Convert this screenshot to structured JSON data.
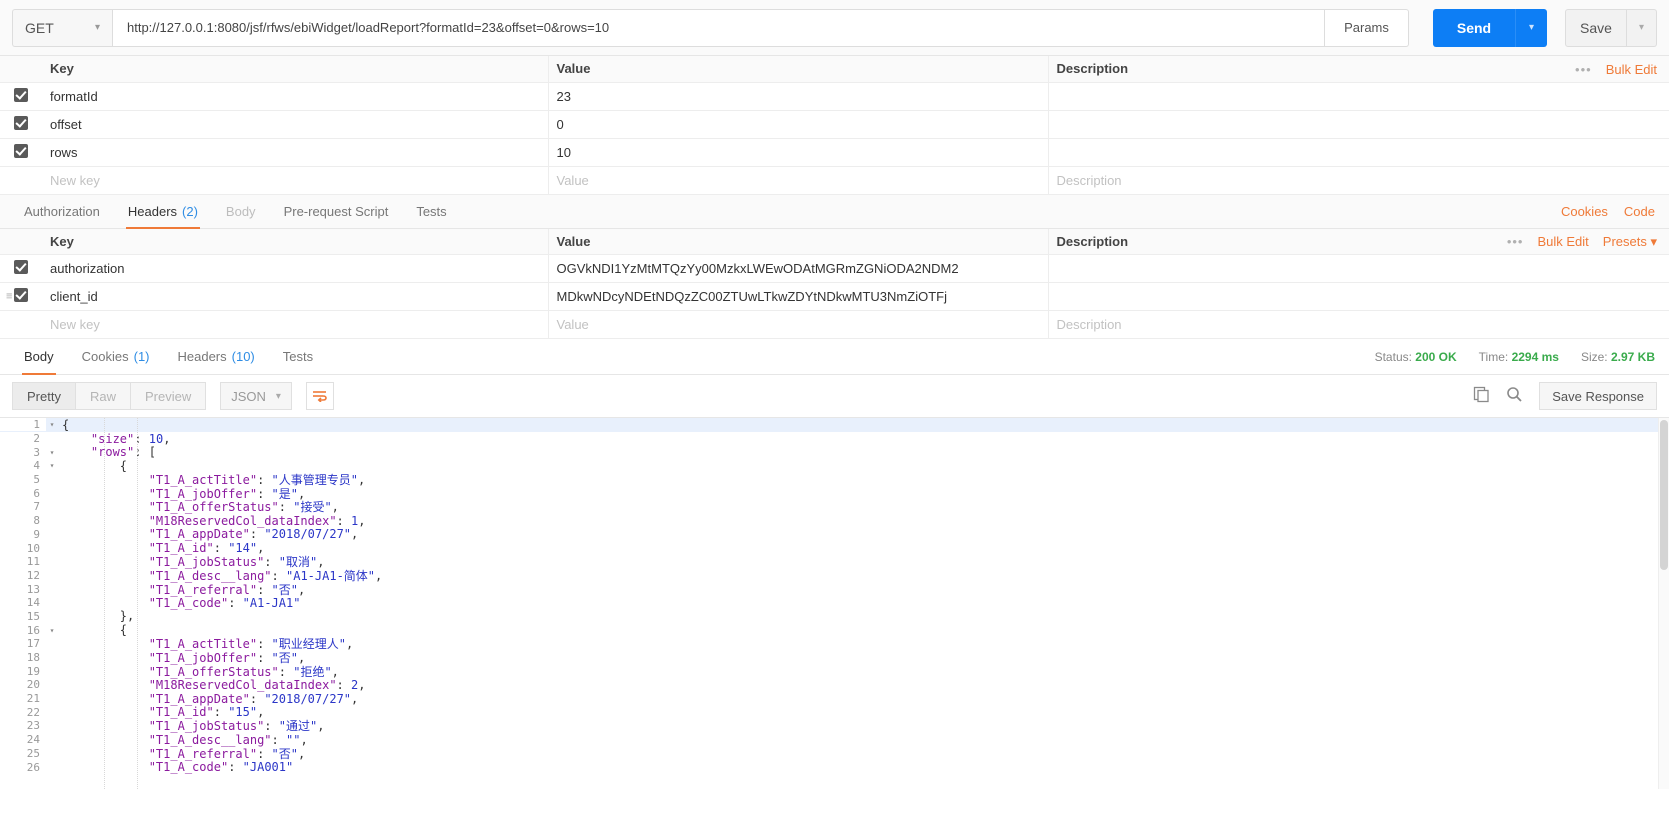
{
  "request": {
    "method": "GET",
    "url": "http://127.0.0.1:8080/jsf/rfws/ebiWidget/loadReport?formatId=23&offset=0&rows=10",
    "params_label": "Params",
    "send_label": "Send",
    "save_label": "Save"
  },
  "params_table": {
    "headers": {
      "key": "Key",
      "value": "Value",
      "description": "Description"
    },
    "bulk_edit": "Bulk Edit",
    "rows": [
      {
        "checked": true,
        "key": "formatId",
        "value": "23",
        "description": ""
      },
      {
        "checked": true,
        "key": "offset",
        "value": "0",
        "description": ""
      },
      {
        "checked": true,
        "key": "rows",
        "value": "10",
        "description": ""
      }
    ],
    "new_row": {
      "key": "New key",
      "value": "Value",
      "description": "Description"
    }
  },
  "request_tabs": {
    "items": [
      {
        "label": "Authorization",
        "count": "",
        "active": false,
        "dim": false
      },
      {
        "label": "Headers",
        "count": "(2)",
        "active": true,
        "dim": false
      },
      {
        "label": "Body",
        "count": "",
        "active": false,
        "dim": true
      },
      {
        "label": "Pre-request Script",
        "count": "",
        "active": false,
        "dim": false
      },
      {
        "label": "Tests",
        "count": "",
        "active": false,
        "dim": false
      }
    ],
    "cookies_link": "Cookies",
    "code_link": "Code"
  },
  "headers_table": {
    "headers": {
      "key": "Key",
      "value": "Value",
      "description": "Description"
    },
    "bulk_edit": "Bulk Edit",
    "presets": "Presets",
    "rows": [
      {
        "checked": true,
        "key": "authorization",
        "value": "OGVkNDI1YzMtMTQzYy00MzkxLWEwODAtMGRmZGNiODA2NDM2",
        "description": ""
      },
      {
        "checked": true,
        "key": "client_id",
        "value": "MDkwNDcyNDEtNDQzZC00ZTUwLTkwZDYtNDkwMTU3NmZiOTFj",
        "description": ""
      }
    ],
    "new_row": {
      "key": "New key",
      "value": "Value",
      "description": "Description"
    }
  },
  "response_tabs": {
    "items": [
      {
        "label": "Body",
        "count": "",
        "active": true
      },
      {
        "label": "Cookies",
        "count": "(1)",
        "active": false
      },
      {
        "label": "Headers",
        "count": "(10)",
        "active": false
      },
      {
        "label": "Tests",
        "count": "",
        "active": false
      }
    ],
    "status_label": "Status:",
    "status_value": "200 OK",
    "time_label": "Time:",
    "time_value": "2294 ms",
    "size_label": "Size:",
    "size_value": "2.97 KB"
  },
  "body_toolbar": {
    "views": [
      "Pretty",
      "Raw",
      "Preview"
    ],
    "active_view": "Pretty",
    "format": "JSON",
    "wrap_icon": "word-wrap-icon",
    "copy_icon": "copy-icon",
    "search_icon": "search-icon",
    "save_response": "Save Response"
  },
  "code": {
    "lines": [
      {
        "n": "1",
        "fold": "▾",
        "text": "{",
        "hl": true
      },
      {
        "n": "2",
        "fold": "",
        "text": "    \"size\": 10,"
      },
      {
        "n": "3",
        "fold": "▾",
        "text": "    \"rows\": ["
      },
      {
        "n": "4",
        "fold": "▾",
        "text": "        {"
      },
      {
        "n": "5",
        "fold": "",
        "text": "            \"T1_A_actTitle\": \"人事管理专员\","
      },
      {
        "n": "6",
        "fold": "",
        "text": "            \"T1_A_jobOffer\": \"是\","
      },
      {
        "n": "7",
        "fold": "",
        "text": "            \"T1_A_offerStatus\": \"接受\","
      },
      {
        "n": "8",
        "fold": "",
        "text": "            \"M18ReservedCol_dataIndex\": 1,"
      },
      {
        "n": "9",
        "fold": "",
        "text": "            \"T1_A_appDate\": \"2018/07/27\","
      },
      {
        "n": "10",
        "fold": "",
        "text": "            \"T1_A_id\": \"14\","
      },
      {
        "n": "11",
        "fold": "",
        "text": "            \"T1_A_jobStatus\": \"取消\","
      },
      {
        "n": "12",
        "fold": "",
        "text": "            \"T1_A_desc__lang\": \"A1-JA1-简体\","
      },
      {
        "n": "13",
        "fold": "",
        "text": "            \"T1_A_referral\": \"否\","
      },
      {
        "n": "14",
        "fold": "",
        "text": "            \"T1_A_code\": \"A1-JA1\""
      },
      {
        "n": "15",
        "fold": "",
        "text": "        },"
      },
      {
        "n": "16",
        "fold": "▾",
        "text": "        {"
      },
      {
        "n": "17",
        "fold": "",
        "text": "            \"T1_A_actTitle\": \"职业经理人\","
      },
      {
        "n": "18",
        "fold": "",
        "text": "            \"T1_A_jobOffer\": \"否\","
      },
      {
        "n": "19",
        "fold": "",
        "text": "            \"T1_A_offerStatus\": \"拒绝\","
      },
      {
        "n": "20",
        "fold": "",
        "text": "            \"M18ReservedCol_dataIndex\": 2,"
      },
      {
        "n": "21",
        "fold": "",
        "text": "            \"T1_A_appDate\": \"2018/07/27\","
      },
      {
        "n": "22",
        "fold": "",
        "text": "            \"T1_A_id\": \"15\","
      },
      {
        "n": "23",
        "fold": "",
        "text": "            \"T1_A_jobStatus\": \"通过\","
      },
      {
        "n": "24",
        "fold": "",
        "text": "            \"T1_A_desc__lang\": \"\","
      },
      {
        "n": "25",
        "fold": "",
        "text": "            \"T1_A_referral\": \"否\","
      },
      {
        "n": "26",
        "fold": "",
        "text": "            \"T1_A_code\": \"JA001\""
      }
    ]
  }
}
